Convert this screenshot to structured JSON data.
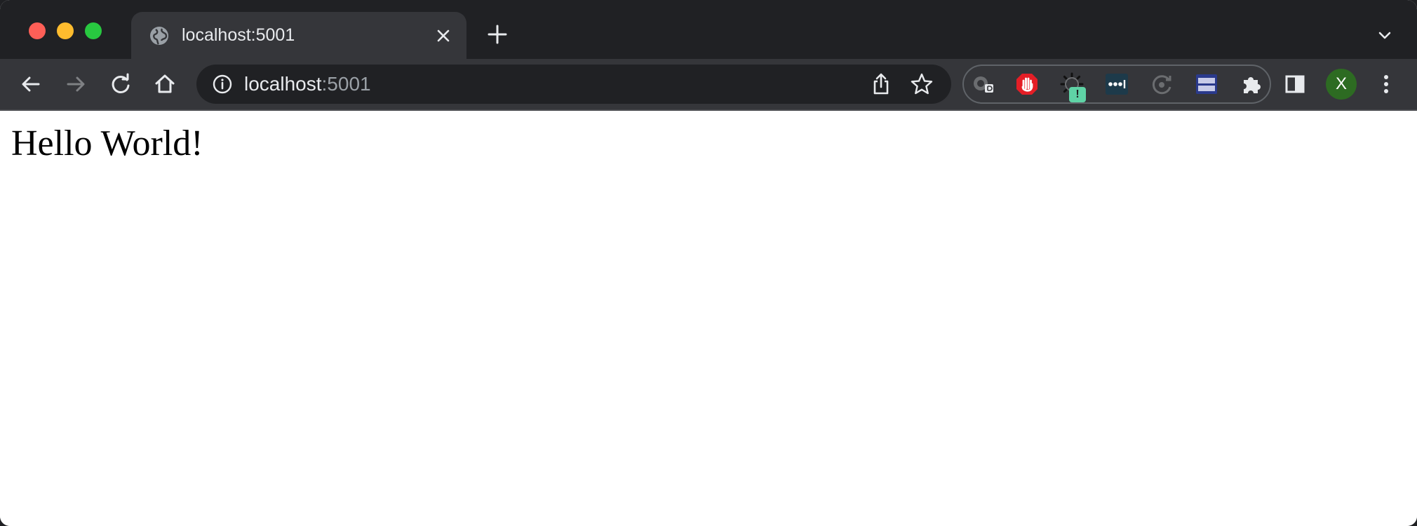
{
  "tab": {
    "title": "localhost:5001"
  },
  "address_bar": {
    "host": "localhost",
    "port": ":5001"
  },
  "profile": {
    "initial": "X",
    "color": "#2d6b22"
  },
  "extensions": {
    "badge": "!",
    "items": [
      "grammar-extension-icon",
      "adblock-icon",
      "loading-extension-icon",
      "dots-extension-icon",
      "refresh-extension-icon",
      "window-extension-icon"
    ]
  },
  "page": {
    "heading": "Hello World!"
  }
}
